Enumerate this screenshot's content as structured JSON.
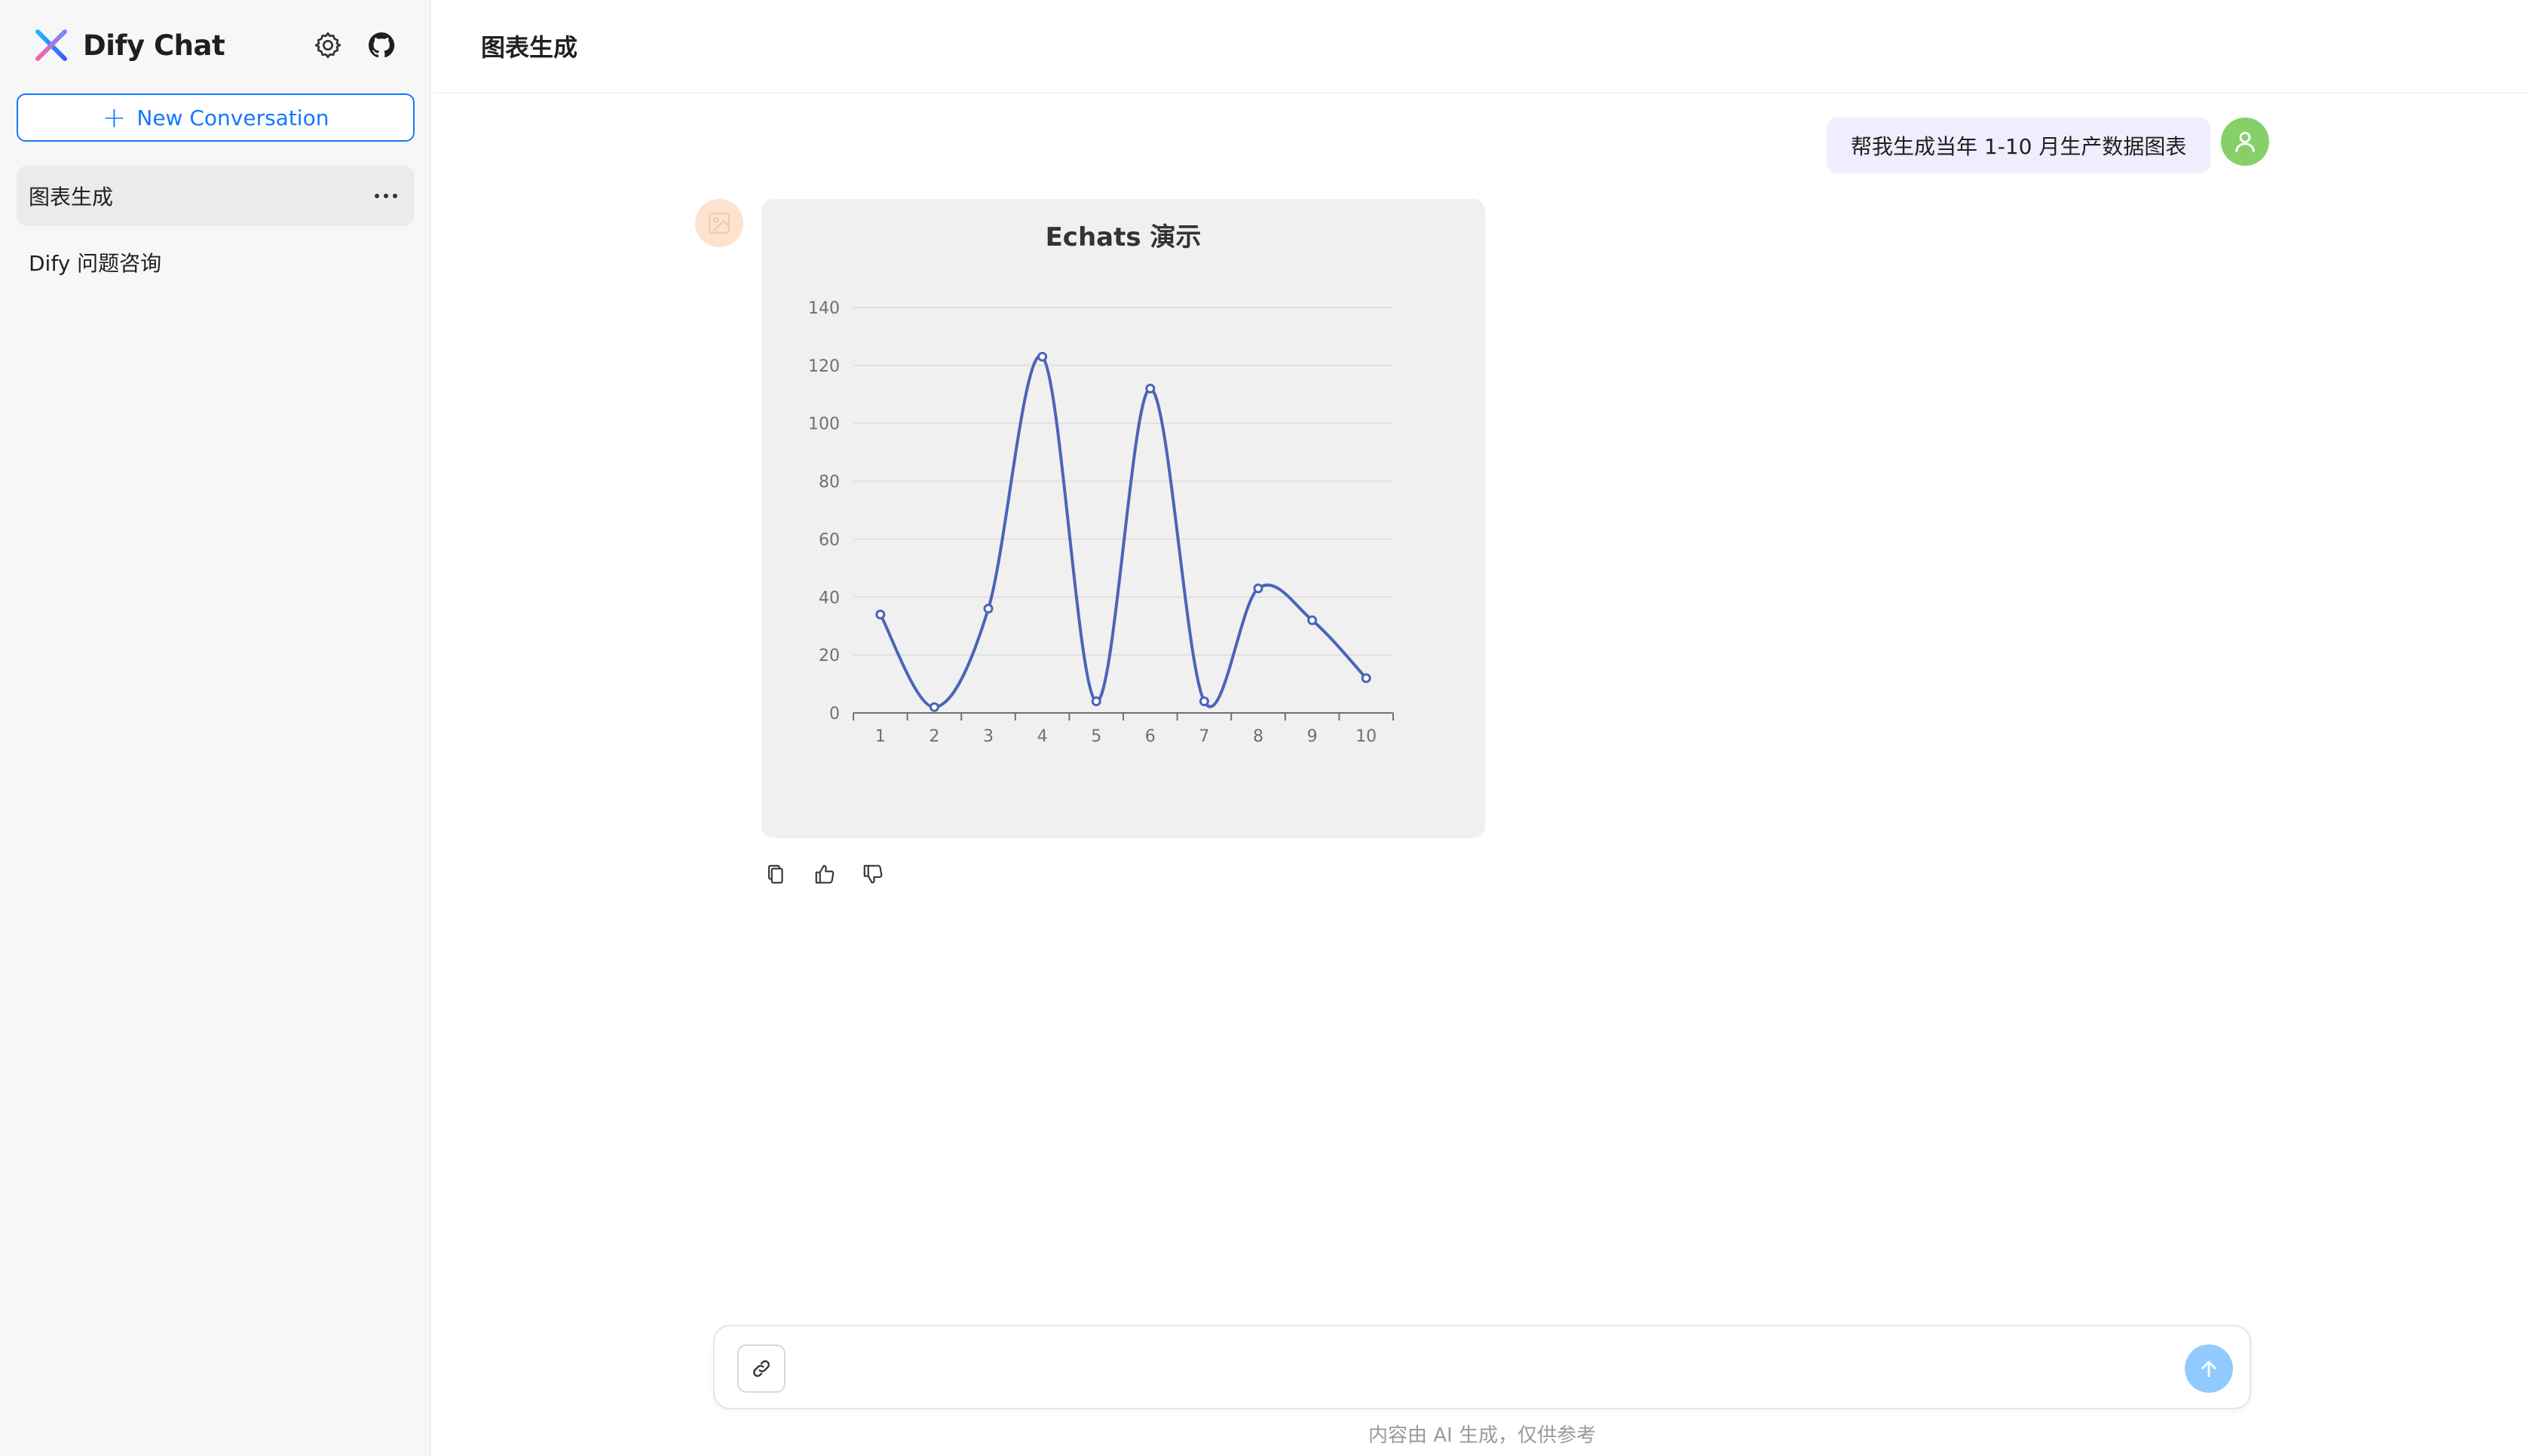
{
  "sidebar": {
    "brand_name": "Dify Chat",
    "new_conversation_label": "New Conversation",
    "conversations": [
      {
        "label": "图表生成",
        "active": true
      },
      {
        "label": "Dify 问题咨询",
        "active": false
      }
    ]
  },
  "header": {
    "title": "图表生成"
  },
  "messages": {
    "user_text": "帮我生成当年 1-10 月生产数据图表"
  },
  "composer": {
    "placeholder": "",
    "disclaimer": "内容由 AI 生成，仅供参考"
  },
  "icons": {
    "logo": "dify-logo-icon",
    "settings": "gear-icon",
    "github": "github-icon",
    "more": "more-dots-icon",
    "user_avatar": "user-icon",
    "bot_avatar": "image-icon",
    "copy": "copy-icon",
    "like": "thumbs-up-icon",
    "dislike": "thumbs-down-icon",
    "attach": "link-icon",
    "send": "arrow-up-icon"
  },
  "colors": {
    "accent": "#1677ff",
    "line": "#4b64b8",
    "user_avatar_bg": "#87d068",
    "bot_avatar_bg": "#fde3cf",
    "send_bg": "#91caff"
  },
  "chart_data": {
    "type": "line",
    "title": "Echats 演示",
    "categories": [
      "1",
      "2",
      "3",
      "4",
      "5",
      "6",
      "7",
      "8",
      "9",
      "10"
    ],
    "values": [
      34,
      2,
      36,
      123,
      4,
      112,
      4,
      43,
      32,
      12
    ],
    "ylim": [
      0,
      140
    ],
    "yticks": [
      0,
      20,
      40,
      60,
      80,
      100,
      120,
      140
    ],
    "smooth": true,
    "grid": true,
    "xlabel": "",
    "ylabel": ""
  }
}
